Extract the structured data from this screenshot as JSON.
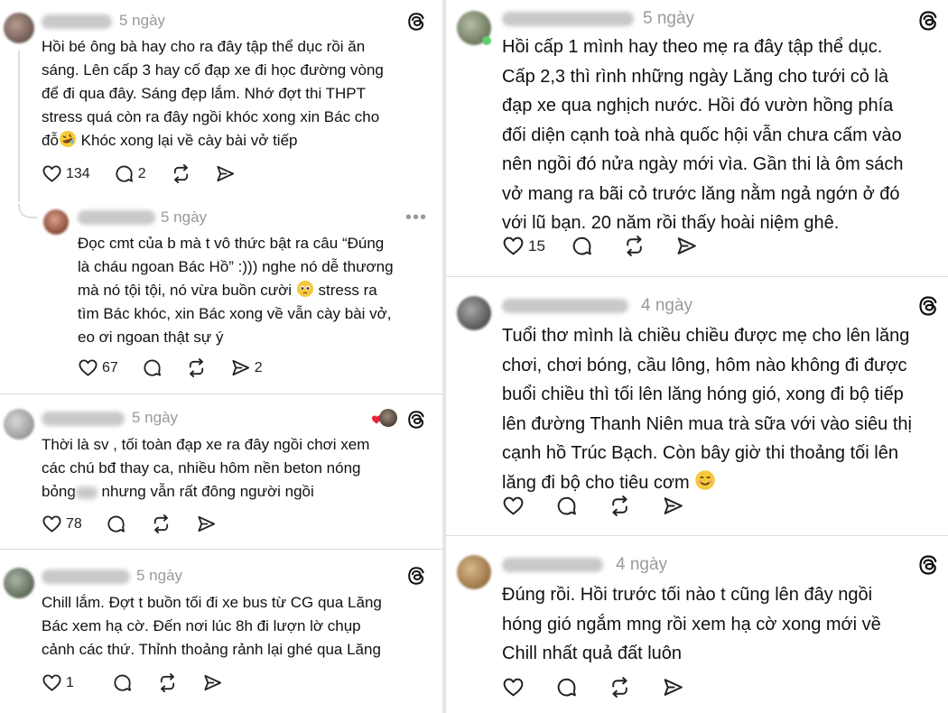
{
  "left": {
    "post1": {
      "time": "5 ngày",
      "text": "Hồi bé ông bà hay cho ra đây tập thể dục rồi ăn\nsáng. Lên cấp 3 hay cố đạp xe đi học đường vòng\nđể đi qua đây. Sáng đẹp lắm. Nhớ đợt thi THPT\nstress quá còn ra đây ngồi khóc xong xin Bác cho\nđỗ",
      "text_tail": " Khóc xong lại về cày bài vở tiếp",
      "likes": "134",
      "replies": "2"
    },
    "reply1": {
      "time": "5 ngày",
      "text_a": "Đọc cmt của b mà t vô thức bật ra câu “Đúng\nlà cháu ngoan Bác Hồ” :))) nghe nó dễ thương\nmà nó tội tội, nó vừa buồn cười",
      "text_b": " stress ra\ntìm Bác khóc, xin Bác xong về vẫn cày bài vở,\neo ơi ngoan thật sự ý",
      "likes": "67",
      "shares": "2"
    },
    "post2": {
      "time": "5 ngày",
      "text_a": "Thời là sv , tối toàn đạp xe ra đây ngồi chơi xem\ncác chú bđ thay ca, nhiều hôm nền beton nóng\nbỏng",
      "text_b": " nhưng vẫn rất đông người ngồi",
      "likes": "78"
    },
    "post3": {
      "time": "5 ngày",
      "text": "Chill lắm. Đợt t buồn tối đi xe bus từ CG qua Lăng\nBác xem hạ cờ. Đến nơi lúc 8h đi lượn lờ chụp\ncảnh các thứ. Thỉnh thoảng rảnh lại ghé qua Lăng",
      "likes": "1"
    }
  },
  "right": {
    "post1": {
      "time": "5 ngày",
      "text": "Hồi cấp 1 mình hay theo mẹ ra đây tập thể dục.\nCấp 2,3 thì rình những ngày Lăng cho tưới cỏ là\nđạp xe qua nghịch nước. Hồi đó vườn hồng phía\nđối diện cạnh toà nhà quốc hội vẫn chưa cấm vào\nnên ngồi đó nửa ngày mới vìa. Gần thi là ôm sách\nvở mang ra bãi cỏ trước lăng nằm ngả ngớn ở đó\nvới lũ bạn. 20 năm rồi thấy hoài niệm ghê.",
      "likes": "15"
    },
    "post2": {
      "time": "4 ngày",
      "text": "Tuổi thơ mình là chiều chiều được mẹ cho lên lăng\nchơi, chơi bóng, cầu lông, hôm nào không đi được\nbuổi chiều thì tối lên lăng hóng gió, xong đi bộ tiếp\nlên đường Thanh Niên mua trà sữa với vào siêu thị\ncạnh hồ Trúc Bạch. Còn bây giờ thi thoảng tối lên\nlăng đi bộ cho tiêu cơm"
    },
    "post3": {
      "time": "4 ngày",
      "text": "Đúng rồi. Hồi trước tối nào t cũng lên đây ngồi\nhóng gió ngắm mng rồi xem hạ cờ xong mới về\nChill nhất quả đất luôn"
    }
  },
  "colors": {
    "text": "#111111",
    "muted": "#9a9a9a",
    "separator": "#dcdcdc",
    "heart_red": "#e8243c"
  },
  "icons": [
    "threads-logo-icon",
    "heart-icon",
    "comment-icon",
    "repost-icon",
    "share-icon",
    "more-icon",
    "rolling-laugh-emoji",
    "pleading-emoji",
    "smiling-emoji"
  ]
}
